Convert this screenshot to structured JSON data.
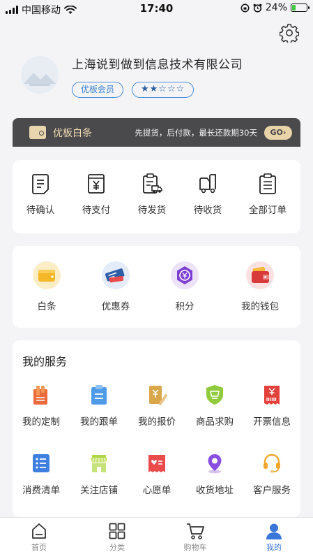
{
  "status_bar": {
    "carrier": "中国移动",
    "time": "17:40",
    "battery": "24%",
    "battery_level": 0.24
  },
  "profile": {
    "company_name": "上海说到做到信息技术有限公司",
    "member_badge": "优板会员",
    "rating_stars": "★★☆☆☆",
    "rating": 2,
    "rating_max": 5
  },
  "credit": {
    "title": "优板白条",
    "description": "先提货，后付款，最长还款期30天",
    "go_label": "GO",
    "go_arrow": "›"
  },
  "orders": {
    "items": [
      {
        "label": "待确认",
        "icon": "document-icon"
      },
      {
        "label": "待支付",
        "icon": "payment-icon"
      },
      {
        "label": "待发货",
        "icon": "clipboard-truck-icon"
      },
      {
        "label": "待收货",
        "icon": "truck-icon"
      },
      {
        "label": "全部订单",
        "icon": "order-list-icon"
      }
    ]
  },
  "wallet": {
    "items": [
      {
        "label": "白条",
        "icon": "wallet-yellow-icon"
      },
      {
        "label": "优惠券",
        "icon": "coupon-icon"
      },
      {
        "label": "积分",
        "icon": "points-icon"
      },
      {
        "label": "我的钱包",
        "icon": "red-wallet-icon"
      }
    ]
  },
  "services": {
    "title": "我的服务",
    "items": [
      {
        "label": "我的定制",
        "icon": "custom-icon"
      },
      {
        "label": "我的跟单",
        "icon": "tracking-icon"
      },
      {
        "label": "我的报价",
        "icon": "quote-icon"
      },
      {
        "label": "商品求购",
        "icon": "purchase-request-icon"
      },
      {
        "label": "开票信息",
        "icon": "invoice-icon"
      },
      {
        "label": "消费清单",
        "icon": "bill-list-icon"
      },
      {
        "label": "关注店铺",
        "icon": "store-icon"
      },
      {
        "label": "心愿单",
        "icon": "wishlist-icon"
      },
      {
        "label": "收货地址",
        "icon": "location-icon"
      },
      {
        "label": "客户服务",
        "icon": "headset-icon"
      }
    ]
  },
  "tab_bar": {
    "items": [
      {
        "label": "首页",
        "icon": "home-icon"
      },
      {
        "label": "分类",
        "icon": "category-icon"
      },
      {
        "label": "购物车",
        "icon": "cart-icon"
      },
      {
        "label": "我的",
        "icon": "profile-icon"
      }
    ],
    "active_index": 3
  },
  "colors": {
    "accent": "#3b76d9",
    "credit_bar": "#4a4a4d",
    "credit_gold": "#e9d3a8",
    "background": "#f4f4f6"
  }
}
